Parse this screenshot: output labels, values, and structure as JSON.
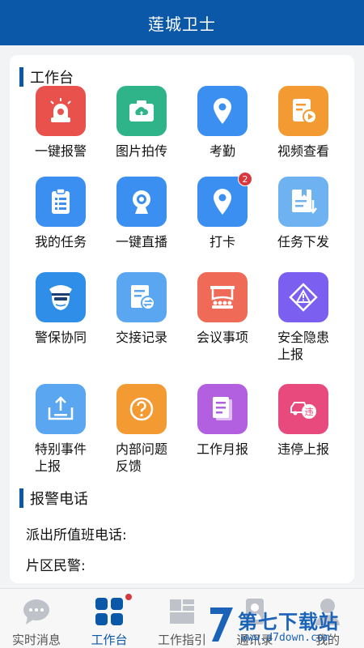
{
  "header": {
    "title": "莲城卫士"
  },
  "workbench": {
    "title": "工作台",
    "items": [
      {
        "label": "一键报警",
        "icon": "alarm-icon",
        "color": "#e9514c"
      },
      {
        "label": "图片拍传",
        "icon": "camera-upload-icon",
        "color": "#2fb48a"
      },
      {
        "label": "考勤",
        "icon": "location-pin-icon",
        "color": "#3a8ff0"
      },
      {
        "label": "视频查看",
        "icon": "video-file-icon",
        "color": "#f39a32"
      },
      {
        "label": "我的任务",
        "icon": "clipboard-icon",
        "color": "#3a8ff0"
      },
      {
        "label": "一键直播",
        "icon": "webcam-icon",
        "color": "#3a8ff0"
      },
      {
        "label": "打卡",
        "icon": "checkin-pin-icon",
        "color": "#3a8ff0",
        "badge": "2"
      },
      {
        "label": "任务下发",
        "icon": "task-dispatch-icon",
        "color": "#6fb2f2"
      },
      {
        "label": "警保协同",
        "icon": "police-officer-icon",
        "color": "#2f8fe8"
      },
      {
        "label": "交接记录",
        "icon": "handover-record-icon",
        "color": "#5aa6f0"
      },
      {
        "label": "会议事项",
        "icon": "meeting-icon",
        "color": "#ef6a57"
      },
      {
        "label": "安全隐患上报",
        "icon": "hazard-warning-icon",
        "color": "#7a5ff0"
      },
      {
        "label": "特别事件上报",
        "icon": "upload-tray-icon",
        "color": "#5aa6f0"
      },
      {
        "label": "内部问题反馈",
        "icon": "question-icon",
        "color": "#f39a32"
      },
      {
        "label": "工作月报",
        "icon": "monthly-report-icon",
        "color": "#b25fe0"
      },
      {
        "label": "违停上报",
        "icon": "illegal-parking-icon",
        "color": "#e84a7e"
      }
    ]
  },
  "police_phone": {
    "title": "报警电话",
    "station_label": "派出所值班电话:",
    "area_label": "片区民警:"
  },
  "tabbar": {
    "tabs": [
      {
        "label": "实时消息",
        "icon": "chat-bubble-icon"
      },
      {
        "label": "工作台",
        "icon": "grid-icon"
      },
      {
        "label": "工作指引",
        "icon": "guide-icon"
      },
      {
        "label": "通讯录",
        "icon": "contacts-icon"
      },
      {
        "label": "我的",
        "icon": "profile-icon"
      }
    ]
  },
  "watermark": {
    "title": "第七下载站",
    "url": "www.d7down.com"
  }
}
